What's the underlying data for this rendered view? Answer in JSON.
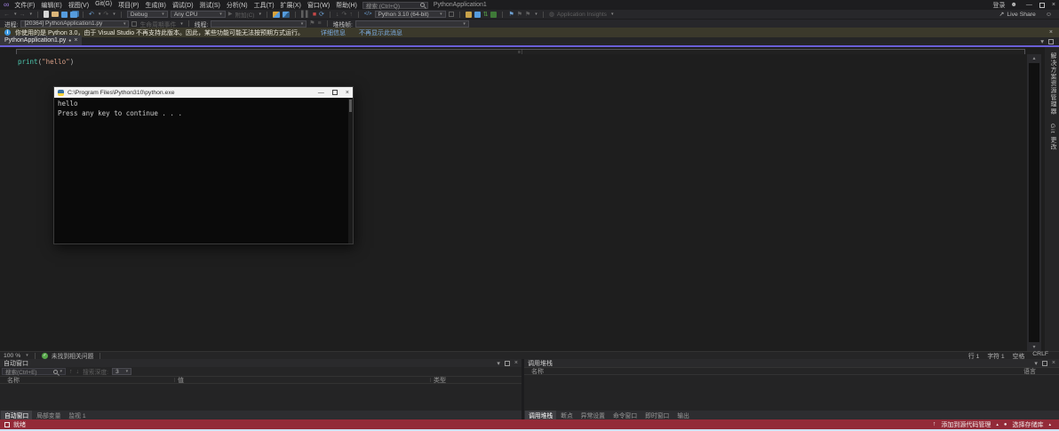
{
  "titlebar": {
    "menus": [
      "文件(F)",
      "编辑(E)",
      "视图(V)",
      "Git(G)",
      "项目(P)",
      "生成(B)",
      "调试(D)",
      "测试(S)",
      "分析(N)",
      "工具(T)",
      "扩展(X)",
      "窗口(W)",
      "帮助(H)"
    ],
    "search_placeholder": "搜索 (Ctrl+Q)",
    "title": "PythonApplication1",
    "signin": "登录"
  },
  "toolbar": {
    "config_dropdown": "Debug",
    "platform_dropdown": "Any CPU",
    "attach_label": "附加(C)",
    "python_dropdown": "Python 3.10 (64-bit)",
    "app_insights": "Application Insights",
    "live_share": "Live Share"
  },
  "debug_location": {
    "process_label": "进程:",
    "process_value": "[20364] PythonApplication1.py",
    "lifecycle_label": "生命周期事件",
    "thread_label": "线程:",
    "stack_label": "堆栈帧:"
  },
  "infobar": {
    "message": "你使用的是 Python 3.0，由于 Visual Studio 不再支持此版本。因此，某些功能可能无法按预期方式运行。",
    "link_details": "详细信息",
    "link_dismiss": "不再显示此消息"
  },
  "editor": {
    "tab": "PythonApplication1.py",
    "code": {
      "function": "print",
      "open": "(",
      "string": "\"hello\"",
      "close": ")"
    }
  },
  "console": {
    "title": "C:\\Program Files\\Python310\\python.exe",
    "lines": [
      "hello",
      "Press any key to continue . . ."
    ]
  },
  "side_tabs": [
    "解决方案资源管理器",
    "Git 更改"
  ],
  "editor_status": {
    "zoom": "100 %",
    "health": "未找到相关问题",
    "line": "行 1",
    "char": "字符 1",
    "spaces": "空格",
    "eol": "CRLF"
  },
  "autos_panel": {
    "title": "自动窗口",
    "search_placeholder": "搜索(Ctrl+E)",
    "depth_label": "搜索深度:",
    "depth_value": "3",
    "columns": [
      "名称",
      "值",
      "类型"
    ],
    "tabs": [
      "自动窗口",
      "局部变量",
      "监视 1"
    ]
  },
  "callstack_panel": {
    "title": "调用堆栈",
    "columns": [
      "名称",
      "语言"
    ],
    "tabs": [
      "调用堆栈",
      "断点",
      "异常设置",
      "命令窗口",
      "即时窗口",
      "输出"
    ]
  },
  "statusbar": {
    "ready": "就绪",
    "add_source_control": "添加到源代码管理",
    "select_repo": "选择存储库"
  },
  "colors": {
    "accent_tab_underline": "#6a5fd6",
    "statusbar_background": "#932a38",
    "health_green": "#57a64a",
    "stop_red": "#c74848",
    "info_icon_blue": "#3a96dd",
    "link_blue": "#7cace0",
    "string_orange": "#d69d85",
    "function_teal": "#4ec9b0",
    "console_background": "#0a0a0a"
  }
}
